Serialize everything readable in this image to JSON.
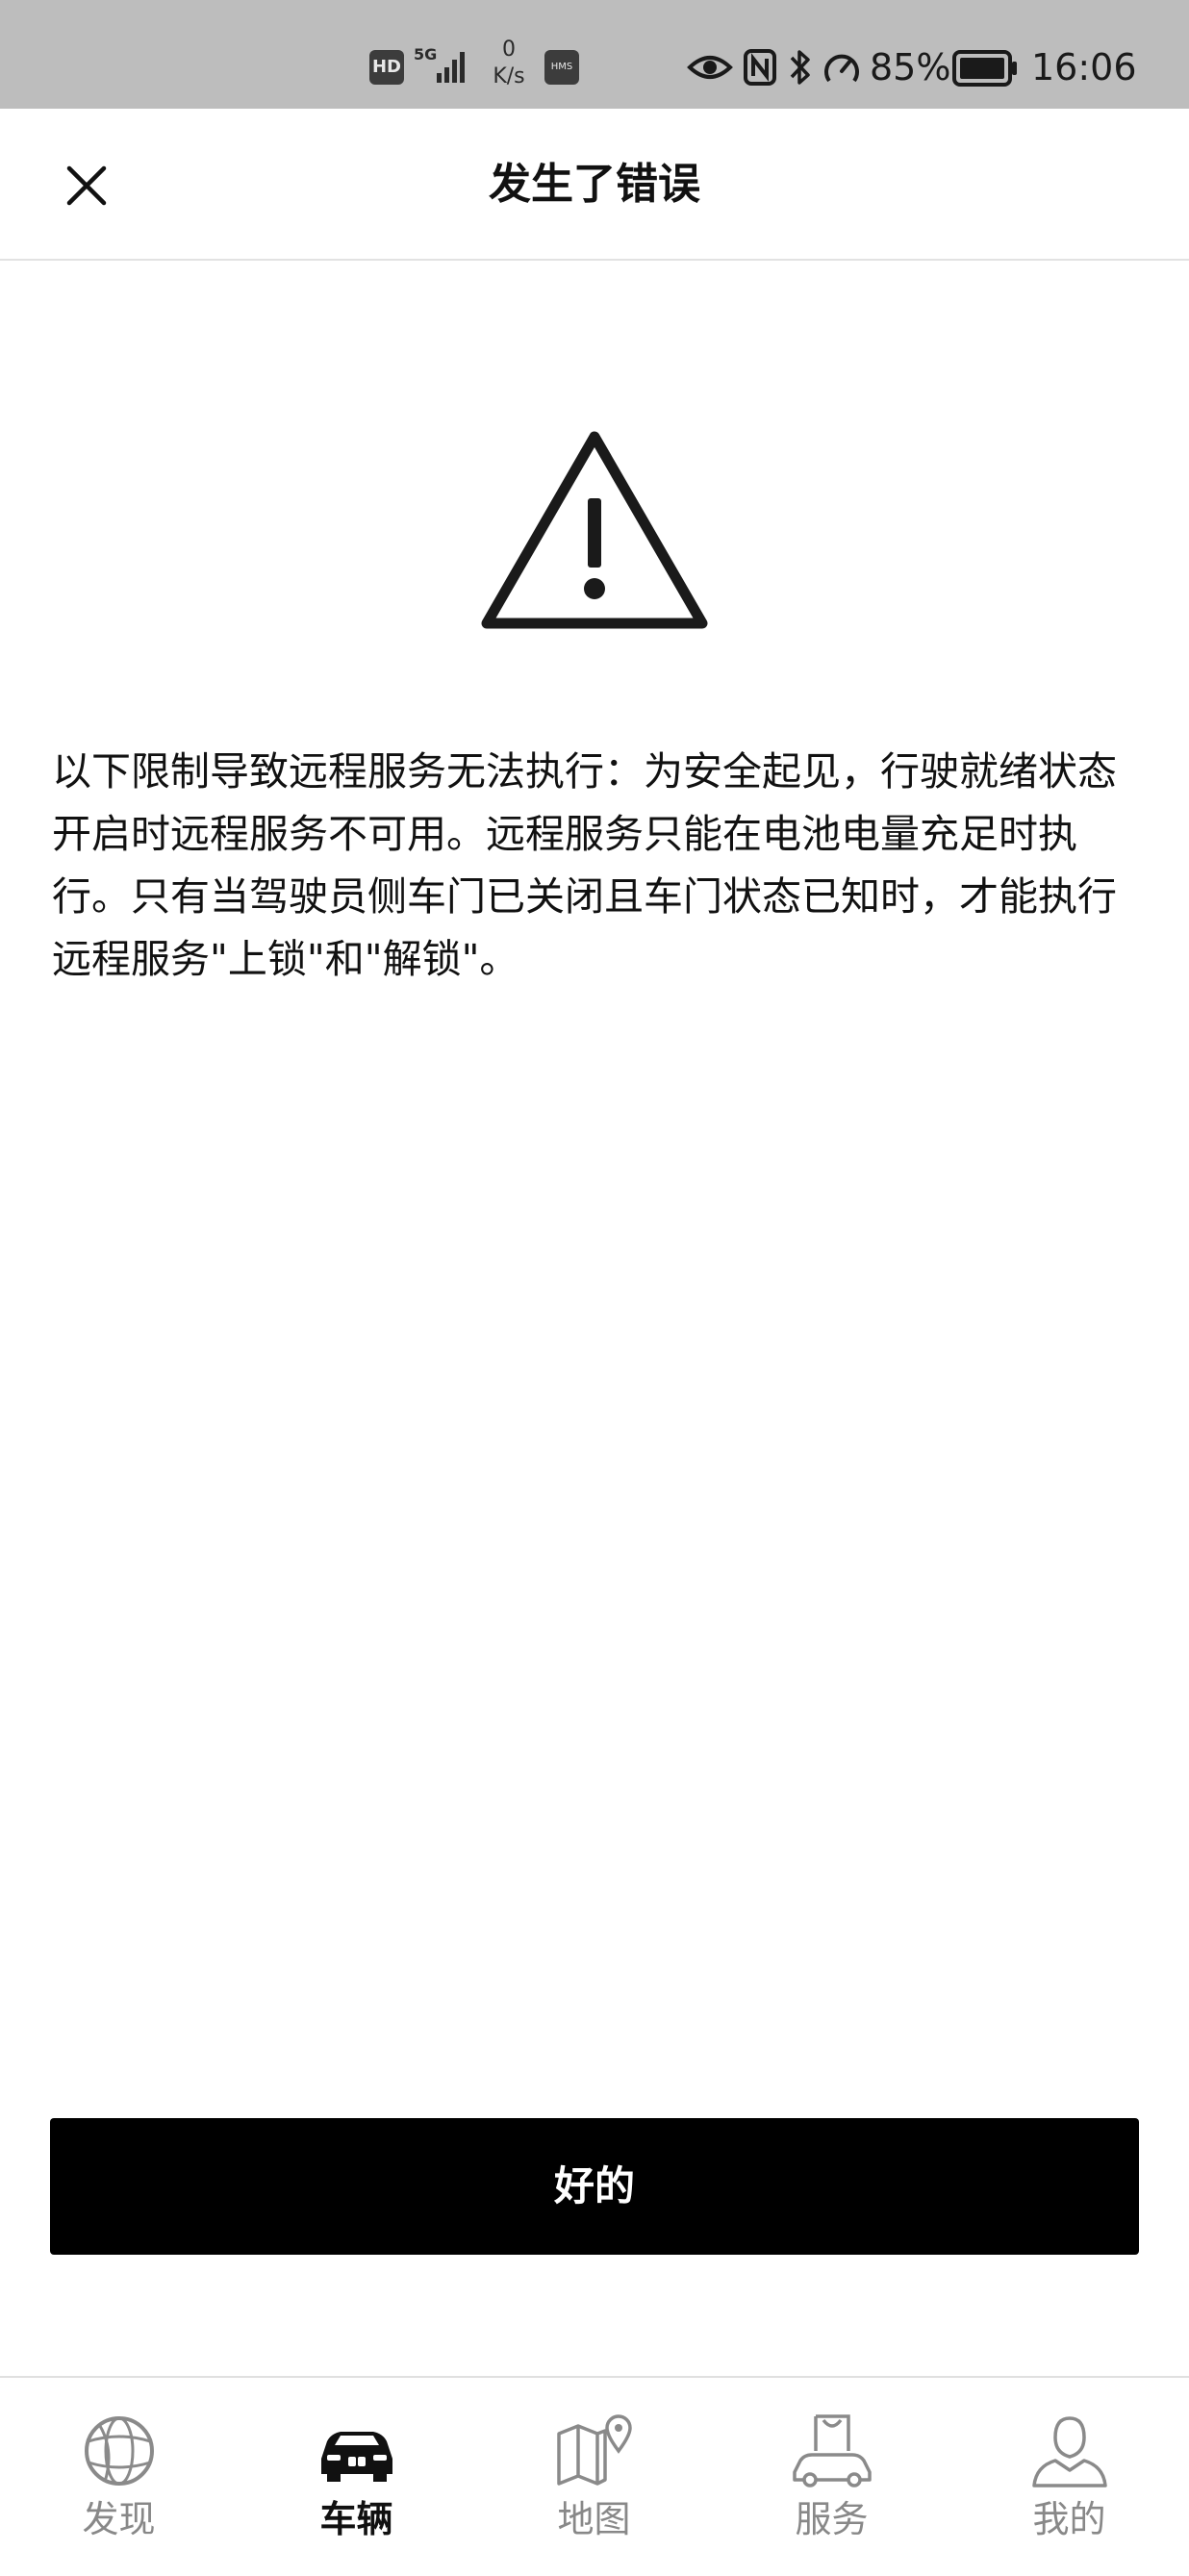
{
  "status_bar": {
    "hd_badge": "HD",
    "network": "5G",
    "speed_value": "0",
    "speed_unit": "K/s",
    "hms_badge": "HMS",
    "battery_percent": "85%",
    "time": "16:06",
    "icons": [
      "eye-icon",
      "nfc-icon",
      "bluetooth-icon",
      "gauge-icon",
      "battery-icon"
    ]
  },
  "header": {
    "title": "发生了错误",
    "close_icon": "close-icon"
  },
  "warning": {
    "icon": "warning-triangle-icon"
  },
  "message": "以下限制导致远程服务无法执行：为安全起见，行驶就绪状态开启时远程服务不可用。远程服务只能在电池电量充足时执行。只有当驾驶员侧车门已关闭且车门状态已知时，才能执行远程服务\"上锁\"和\"解锁\"。",
  "ok_button": "好的",
  "nav": {
    "active_index": 1,
    "items": [
      {
        "label": "发现",
        "icon": "globe-icon"
      },
      {
        "label": "车辆",
        "icon": "car-icon"
      },
      {
        "label": "地图",
        "icon": "map-icon"
      },
      {
        "label": "服务",
        "icon": "service-bag-car-icon"
      },
      {
        "label": "我的",
        "icon": "user-icon"
      }
    ]
  },
  "colors": {
    "status_bar_bg": "#bdbdbd",
    "button_bg": "#000000",
    "button_text": "#ffffff",
    "nav_inactive": "#888888",
    "nav_active": "#111111"
  }
}
